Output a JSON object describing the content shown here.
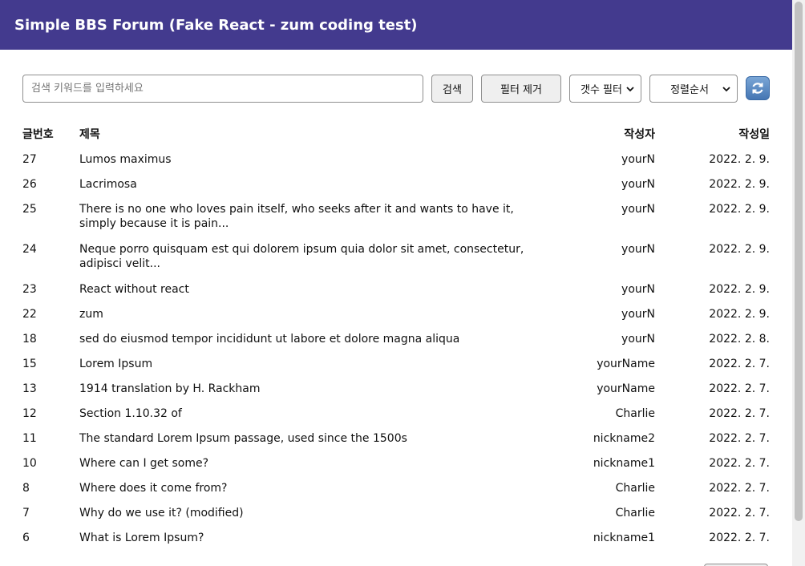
{
  "header": {
    "title": "Simple BBS Forum (Fake React - zum coding test)"
  },
  "toolbar": {
    "search_placeholder": "검색 키워드를 입력하세요",
    "search_button": "검색",
    "clear_filter_button": "필터 제거",
    "count_filter": "갯수 필터",
    "sort_order": "정렬순서",
    "refresh_icon": "refresh-icon"
  },
  "table": {
    "columns": [
      "글번호",
      "제목",
      "작성자",
      "작성일"
    ],
    "rows": [
      {
        "id": "27",
        "title": "Lumos maximus",
        "author": "yourN",
        "date": "2022. 2. 9."
      },
      {
        "id": "26",
        "title": "Lacrimosa",
        "author": "yourN",
        "date": "2022. 2. 9."
      },
      {
        "id": "25",
        "title": "There is no one who loves pain itself, who seeks after it and wants to have it, simply because it is pain...",
        "author": "yourN",
        "date": "2022. 2. 9."
      },
      {
        "id": "24",
        "title": "Neque porro quisquam est qui dolorem ipsum quia dolor sit amet, consectetur, adipisci velit...",
        "author": "yourN",
        "date": "2022. 2. 9."
      },
      {
        "id": "23",
        "title": "React without react",
        "author": "yourN",
        "date": "2022. 2. 9."
      },
      {
        "id": "22",
        "title": "zum",
        "author": "yourN",
        "date": "2022. 2. 9."
      },
      {
        "id": "18",
        "title": "sed do eiusmod tempor incididunt ut labore et dolore magna aliqua",
        "author": "yourN",
        "date": "2022. 2. 8."
      },
      {
        "id": "15",
        "title": "Lorem Ipsum",
        "author": "yourName",
        "date": "2022. 2. 7."
      },
      {
        "id": "13",
        "title": "1914 translation by H. Rackham",
        "author": "yourName",
        "date": "2022. 2. 7."
      },
      {
        "id": "12",
        "title": "Section 1.10.32 of",
        "author": "Charlie",
        "date": "2022. 2. 7."
      },
      {
        "id": "11",
        "title": "The standard Lorem Ipsum passage, used since the 1500s",
        "author": "nickname2",
        "date": "2022. 2. 7."
      },
      {
        "id": "10",
        "title": "Where can I get some?",
        "author": "nickname1",
        "date": "2022. 2. 7."
      },
      {
        "id": "8",
        "title": "Where does it come from?",
        "author": "Charlie",
        "date": "2022. 2. 7."
      },
      {
        "id": "7",
        "title": "Why do we use it? (modified)",
        "author": "Charlie",
        "date": "2022. 2. 7."
      },
      {
        "id": "6",
        "title": "What is Lorem Ipsum?",
        "author": "nickname1",
        "date": "2022. 2. 7."
      }
    ]
  },
  "colors": {
    "header_bg": "#433a8e",
    "header_text": "#ffffff"
  }
}
